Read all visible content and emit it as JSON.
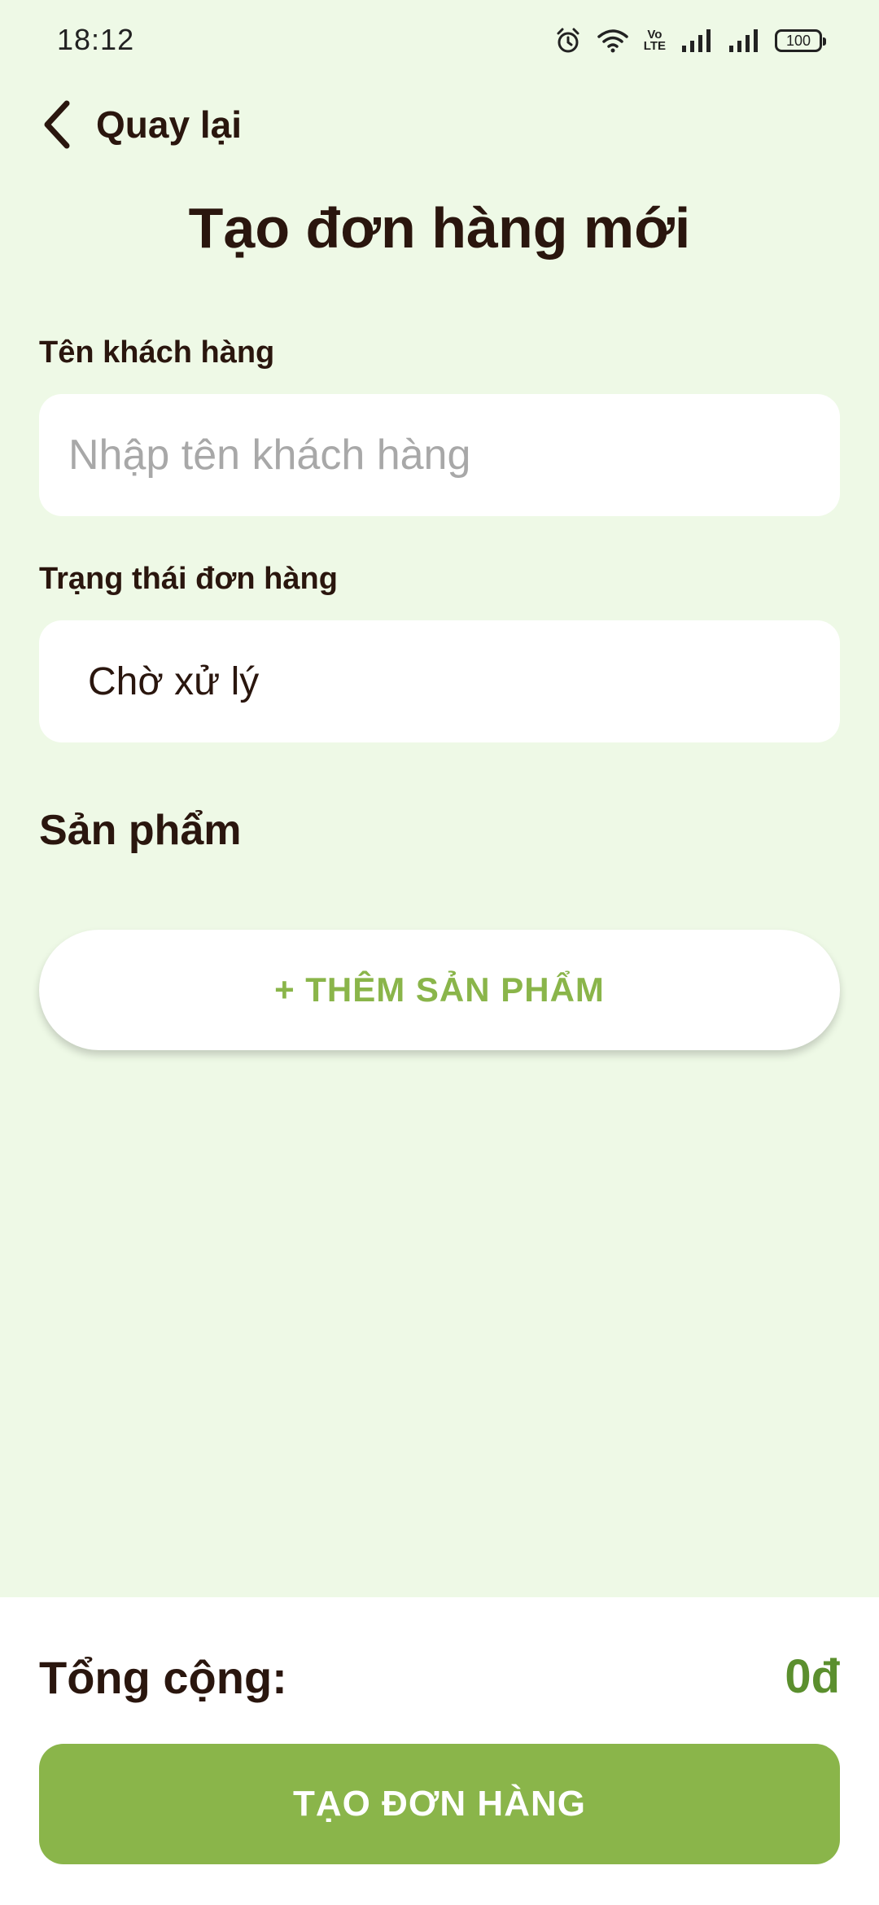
{
  "status_bar": {
    "time": "18:12",
    "network_badge_top": "Vo",
    "network_badge_bottom": "LTE",
    "battery": "100",
    "icons": [
      "alarm-icon",
      "wifi-icon",
      "volte-icon",
      "signal-icon",
      "signal-icon",
      "battery-icon"
    ]
  },
  "header": {
    "back_label": "Quay lại",
    "title": "Tạo đơn hàng mới"
  },
  "form": {
    "customer_label": "Tên khách hàng",
    "customer_value": "",
    "customer_placeholder": "Nhập tên khách hàng",
    "status_label": "Trạng thái đơn hàng",
    "status_value": "Chờ xử lý"
  },
  "products": {
    "section_title": "Sản phẩm",
    "add_button": "+ THÊM SẢN PHẨM"
  },
  "footer": {
    "total_label": "Tổng cộng:",
    "total_value": "0đ",
    "create_button": "TẠO ĐƠN HÀNG"
  },
  "colors": {
    "background": "#eef9e6",
    "accent": "#8ab54a",
    "total": "#5b8f2e",
    "text": "#2a160e"
  }
}
